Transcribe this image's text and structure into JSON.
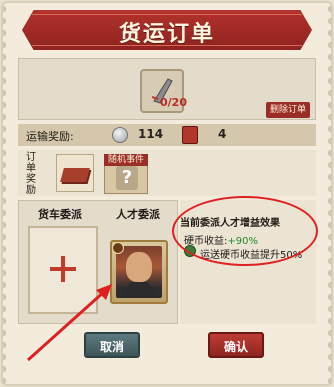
{
  "header": {
    "title": "货运订单"
  },
  "cargo": {
    "count": "0/20",
    "delete_label": "删除订单"
  },
  "transport_reward": {
    "label": "运输奖励:",
    "coin_value": "114",
    "book_value": "4"
  },
  "order_reward": {
    "label": "订单奖励",
    "event_label": "随机事件"
  },
  "dispatch": {
    "truck_tab": "货车委派",
    "talent_tab": "人才委派"
  },
  "buff": {
    "title": "当前委派人才增益效果",
    "coin_label": "硬币收益:",
    "coin_bonus": "+90%",
    "extra": "运送硬币收益提升50%"
  },
  "actions": {
    "cancel": "取消",
    "confirm": "确认"
  },
  "colors": {
    "accent": "#b3322c",
    "highlight": "#e02020",
    "bonus_green": "#1f8b2d"
  }
}
